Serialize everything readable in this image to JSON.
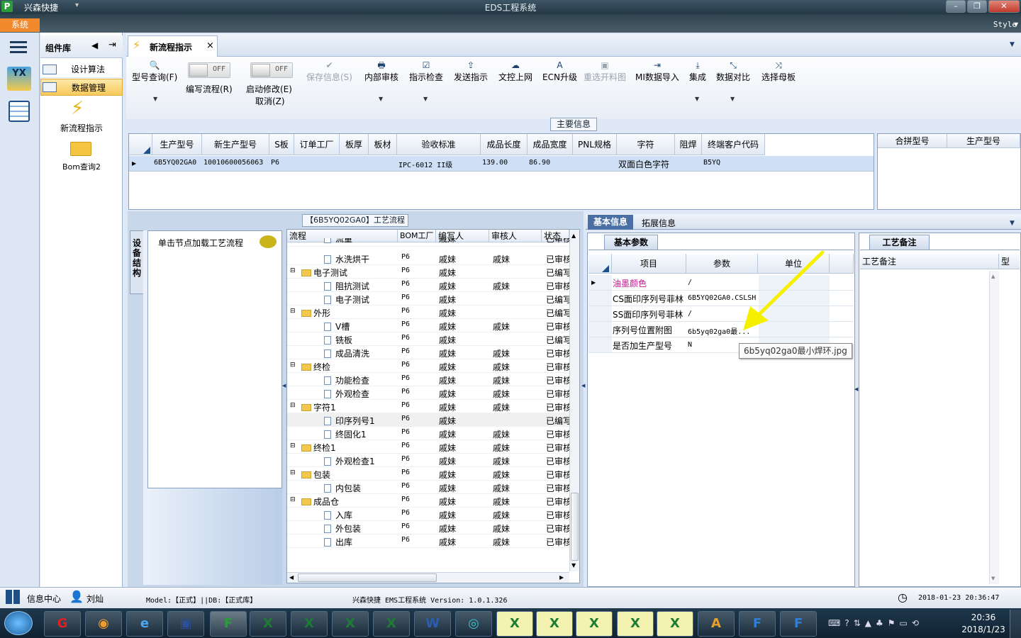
{
  "window": {
    "app_title": "兴森快捷",
    "title": "EDS工程系统",
    "minimize": "–",
    "maximize": "❐",
    "close": "✕"
  },
  "menu": {
    "system_tab": "系统",
    "style": "Style"
  },
  "component_library": {
    "title": "组件库",
    "items": [
      {
        "label": "设计算法"
      },
      {
        "label": "数据管理"
      }
    ],
    "tiles": [
      {
        "label": "新流程指示"
      },
      {
        "label": "Bom查询2"
      }
    ]
  },
  "doc_tab": {
    "label": "新流程指示",
    "close": "×"
  },
  "toolbar": {
    "model_query": "型号查询(F)",
    "toggle_write": {
      "state": "OFF",
      "label": "编写流程(R)"
    },
    "toggle_modify": {
      "state": "OFF",
      "label": "启动修改(E)",
      "label2": "取消(Z)"
    },
    "save_info": "保存信息(S)",
    "internal_review": "内部审核",
    "instruction_check": "指示检查",
    "send_instruction": "发送指示",
    "upload_doc": "文控上网",
    "ecn_upgrade": "ECN升级",
    "reselect_drawing": "重选开料图",
    "mi_import": "MI数据导入",
    "integrate": "集成",
    "data_compare": "数据对比",
    "select_mother": "选择母板"
  },
  "main_info": {
    "label": "主要信息",
    "columns": [
      "生产型号",
      "新生产型号",
      "S板",
      "订单工厂",
      "板厚",
      "板材",
      "验收标准",
      "成品长度",
      "成品宽度",
      "PNL规格",
      "字符",
      "阻焊",
      "终端客户代码"
    ],
    "row": [
      "6B5YQ02GA0",
      "10010600056063",
      "P6",
      "",
      "",
      "",
      "IPC-6012 II级",
      "139.00",
      "86.90",
      "",
      "双面白色字符",
      "",
      "B5YQ"
    ],
    "side_columns": [
      "合拼型号",
      "生产型号"
    ]
  },
  "process": {
    "header": "【6B5YQ02GA0】工艺流程",
    "side_tab": "设备结构",
    "node_hint": "单击节点加载工艺流程",
    "columns": [
      "流程",
      "BOM工厂",
      "编写人",
      "审核人",
      "状态"
    ],
    "rows": [
      {
        "name": "流量",
        "type": "doc",
        "factory": "P6",
        "writer": "戚妹",
        "reviewer": "",
        "status": "已审核"
      },
      {
        "name": "水洗烘干",
        "type": "doc",
        "factory": "P6",
        "writer": "戚妹",
        "reviewer": "戚妹",
        "status": "已审核"
      },
      {
        "name": "电子测试",
        "type": "folder",
        "factory": "P6",
        "writer": "戚妹",
        "reviewer": "",
        "status": "已编写"
      },
      {
        "name": "阻抗测试",
        "type": "doc",
        "factory": "P6",
        "writer": "戚妹",
        "reviewer": "戚妹",
        "status": "已审核"
      },
      {
        "name": "电子测试",
        "type": "doc",
        "factory": "P6",
        "writer": "戚妹",
        "reviewer": "",
        "status": "已编写"
      },
      {
        "name": "外形",
        "type": "folder",
        "factory": "P6",
        "writer": "戚妹",
        "reviewer": "",
        "status": "已编写"
      },
      {
        "name": "V槽",
        "type": "doc",
        "factory": "P6",
        "writer": "戚妹",
        "reviewer": "戚妹",
        "status": "已审核"
      },
      {
        "name": "铣板",
        "type": "doc",
        "factory": "P6",
        "writer": "戚妹",
        "reviewer": "",
        "status": "已编写"
      },
      {
        "name": "成品清洗",
        "type": "doc",
        "factory": "P6",
        "writer": "戚妹",
        "reviewer": "戚妹",
        "status": "已审核"
      },
      {
        "name": "终检",
        "type": "folder",
        "factory": "P6",
        "writer": "戚妹",
        "reviewer": "戚妹",
        "status": "已审核"
      },
      {
        "name": "功能检查",
        "type": "doc",
        "factory": "P6",
        "writer": "戚妹",
        "reviewer": "戚妹",
        "status": "已审核"
      },
      {
        "name": "外观检查",
        "type": "doc",
        "factory": "P6",
        "writer": "戚妹",
        "reviewer": "戚妹",
        "status": "已审核"
      },
      {
        "name": "字符1",
        "type": "folder",
        "factory": "P6",
        "writer": "戚妹",
        "reviewer": "戚妹",
        "status": "已审核"
      },
      {
        "name": "印序列号1",
        "type": "doc",
        "factory": "P6",
        "writer": "戚妹",
        "reviewer": "",
        "status": "已编写"
      },
      {
        "name": "终固化1",
        "type": "doc",
        "factory": "P6",
        "writer": "戚妹",
        "reviewer": "戚妹",
        "status": "已审核"
      },
      {
        "name": "终检1",
        "type": "folder",
        "factory": "P6",
        "writer": "戚妹",
        "reviewer": "戚妹",
        "status": "已审核"
      },
      {
        "name": "外观检查1",
        "type": "doc",
        "factory": "P6",
        "writer": "戚妹",
        "reviewer": "戚妹",
        "status": "已审核"
      },
      {
        "name": "包装",
        "type": "folder",
        "factory": "P6",
        "writer": "戚妹",
        "reviewer": "戚妹",
        "status": "已审核"
      },
      {
        "name": "内包装",
        "type": "doc",
        "factory": "P6",
        "writer": "戚妹",
        "reviewer": "戚妹",
        "status": "已审核"
      },
      {
        "name": "成品仓",
        "type": "folder",
        "factory": "P6",
        "writer": "戚妹",
        "reviewer": "戚妹",
        "status": "已审核"
      },
      {
        "name": "入库",
        "type": "doc",
        "factory": "P6",
        "writer": "戚妹",
        "reviewer": "戚妹",
        "status": "已审核"
      },
      {
        "name": "外包装",
        "type": "doc",
        "factory": "P6",
        "writer": "戚妹",
        "reviewer": "戚妹",
        "status": "已审核"
      },
      {
        "name": "出库",
        "type": "doc",
        "factory": "P6",
        "writer": "戚妹",
        "reviewer": "戚妹",
        "status": "已审核"
      }
    ]
  },
  "details": {
    "tabs": [
      "基本信息",
      "拓展信息"
    ],
    "subtab": "基本参数",
    "columns": [
      "项目",
      "参数",
      "单位"
    ],
    "rows": [
      {
        "item": "油墨颜色",
        "param": "/"
      },
      {
        "item": "CS面印序列号菲林",
        "param": "6B5YQ02GA0.CSLSH"
      },
      {
        "item": "SS面印序列号菲林",
        "param": "/"
      },
      {
        "item": "序列号位置附图",
        "param": "6b5yq02ga0最..."
      },
      {
        "item": "是否加生产型号",
        "param": "N"
      }
    ],
    "tooltip": "6b5yq02ga0最小焊环.jpg",
    "notes_tab": "工艺备注",
    "notes_columns": [
      "工艺备注",
      "型"
    ]
  },
  "statusbar": {
    "info_center": "信息中心",
    "user": "刘灿",
    "model": "Model:【正式】||DB:【正式库】",
    "version": "兴森快捷 EMS工程系统 Version: 1.0.1.326",
    "datetime": "2018-01-23 20:36:47"
  },
  "taskbar": {
    "time": "20:36",
    "date": "2018/1/23"
  },
  "colors": {
    "accent": "#f08a2c",
    "selected_row": "#cfe0f6",
    "tab_active": "#4a6fa5",
    "arrow": "#f5f000",
    "ink_item": "#c0188c"
  }
}
